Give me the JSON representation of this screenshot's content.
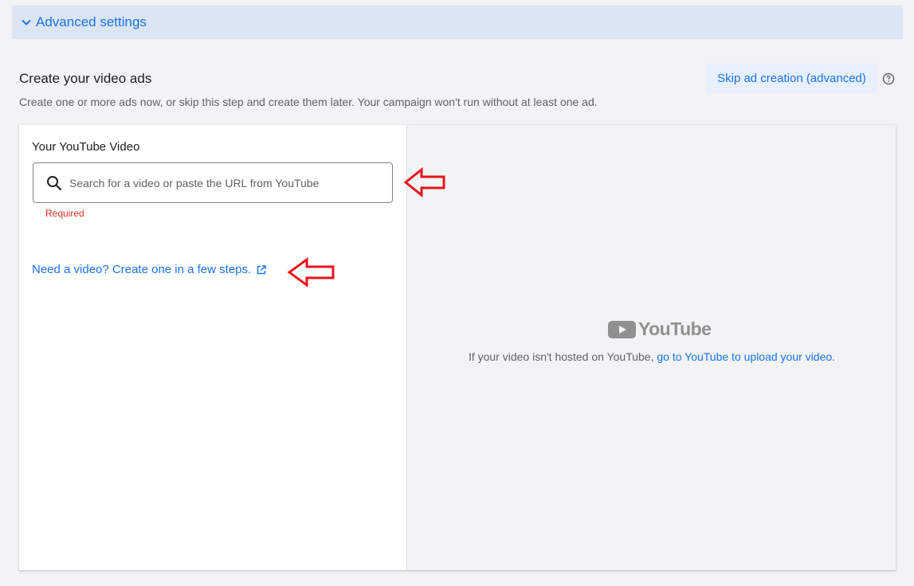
{
  "advanced": {
    "label": "Advanced settings"
  },
  "section": {
    "title": "Create your video ads",
    "description": "Create one or more ads now, or skip this step and create them later. Your campaign won't run without at least one ad.",
    "skip_label": "Skip ad creation (advanced)"
  },
  "video_field": {
    "label": "Your YouTube Video",
    "placeholder": "Search for a video or paste the URL from YouTube",
    "value": "",
    "error": "Required"
  },
  "create_link": {
    "label": "Need a video? Create one in a few steps."
  },
  "youtube_panel": {
    "logo_text": "YouTube",
    "note_prefix": "If your video isn't hosted on YouTube, ",
    "note_link": "go to YouTube to upload your video",
    "note_suffix": "."
  },
  "colors": {
    "accent": "#1a73e8",
    "error": "#d93025",
    "annotation_arrow": "#e8141c",
    "advanced_bar_bg": "#dbe5f3"
  },
  "icons": [
    "chevron-down-icon",
    "help-icon",
    "search-icon",
    "open-in-new-icon",
    "youtube-play-icon",
    "annotation-arrow"
  ]
}
